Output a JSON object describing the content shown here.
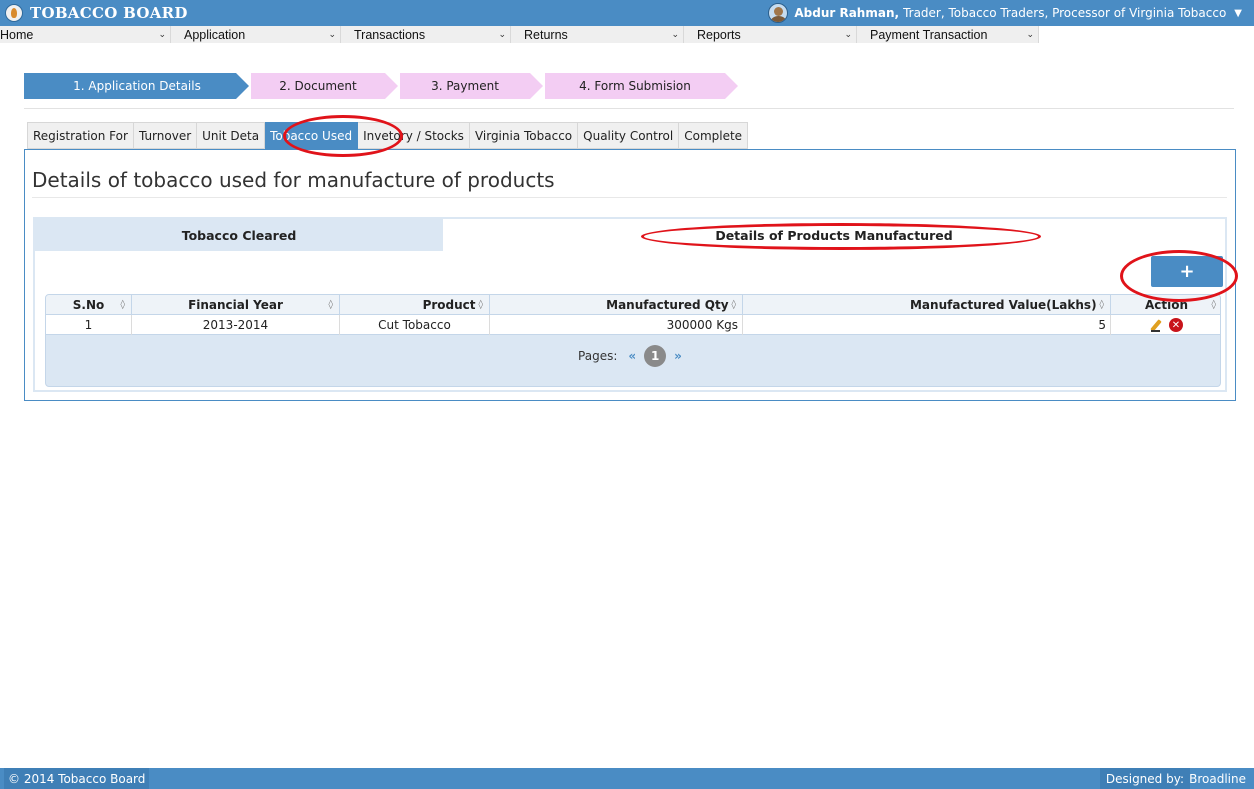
{
  "app": {
    "brand": "TOBACCO BOARD"
  },
  "user": {
    "name": "Abdur Rahman,",
    "roles": "Trader, Tobacco Traders, Processor of Virginia Tobacco"
  },
  "menu": [
    {
      "label": "Home"
    },
    {
      "label": "Application"
    },
    {
      "label": "Transactions"
    },
    {
      "label": "Returns"
    },
    {
      "label": "Reports"
    },
    {
      "label": "Payment Transaction"
    }
  ],
  "wizard": [
    {
      "label": "1. Application Details",
      "state": "active"
    },
    {
      "label": "2. Document",
      "state": "inactive"
    },
    {
      "label": "3. Payment",
      "state": "inactive"
    },
    {
      "label": "4. Form Submision",
      "state": "inactive"
    }
  ],
  "tabs": [
    {
      "label": "Registration For"
    },
    {
      "label": "Turnover"
    },
    {
      "label": "Unit Deta"
    },
    {
      "label": "Tobacco Used",
      "active": true
    },
    {
      "label": "Invetory / Stocks"
    },
    {
      "label": "Virginia Tobacco"
    },
    {
      "label": "Quality Control"
    },
    {
      "label": "Complete"
    }
  ],
  "panel": {
    "title": "Details of tobacco used for manufacture of products",
    "subtabs": [
      "Tobacco Cleared",
      "Details of Products Manufactured"
    ],
    "add_label": "+"
  },
  "table": {
    "headers": [
      "S.No",
      "Financial Year",
      "Product",
      "Manufactured Qty",
      "Manufactured Value(Lakhs)",
      "Action"
    ],
    "rows": [
      {
        "sno": "1",
        "year": "2013-2014",
        "product": "Cut Tobacco",
        "qty": "300000 Kgs",
        "value": "5"
      }
    ]
  },
  "pager": {
    "label": "Pages:",
    "prev": "«",
    "current": "1",
    "next": "»"
  },
  "footer": {
    "copyright": "© 2014 Tobacco Board",
    "designed_by": "Designed by:",
    "company": "Broadline"
  },
  "colors": {
    "primary": "#4a8cc4",
    "wizard_inactive": "#f3cdf3",
    "annotation": "#e0131a"
  }
}
